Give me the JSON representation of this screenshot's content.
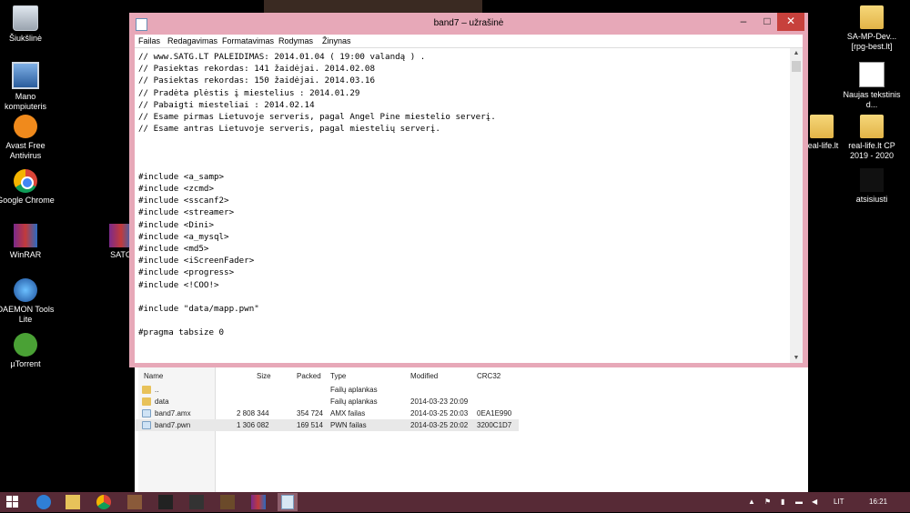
{
  "desktop": {
    "icons_left": [
      {
        "label": "Šiukšlinė",
        "icon": "recycle-bin-icon"
      },
      {
        "label": "Mano kompiuteris",
        "icon": "computer-icon"
      },
      {
        "label": "Avast Free Antivirus",
        "icon": "avast-icon"
      },
      {
        "label": "Google Chrome",
        "icon": "chrome-icon"
      },
      {
        "label": "WinRAR",
        "icon": "winrar-icon"
      },
      {
        "label": "DAEMON Tools Lite",
        "icon": "daemon-tools-icon"
      },
      {
        "label": "µTorrent",
        "icon": "utorrent-icon"
      }
    ],
    "icon_partial": "SATG",
    "icons_right": [
      {
        "label": "SA-MP-Dev... [rpg-best.lt]",
        "icon": "folder-icon"
      },
      {
        "label": "Naujas tekstinis d...",
        "icon": "text-document-icon"
      },
      {
        "label": "real-life.lt",
        "icon": "folder-icon"
      },
      {
        "label": "real-life.lt CP 2019 - 2020",
        "icon": "folder-icon"
      },
      {
        "label": "atsisiusti",
        "icon": "folder-icon"
      }
    ]
  },
  "notepad": {
    "title": "band7 – užrašinė",
    "menu": [
      "Failas",
      "Redagavimas",
      "Formatavimas",
      "Rodymas",
      "Žinynas"
    ],
    "lines": [
      "// www.SATG.LT PALEIDIMAS: 2014.01.04 ( 19:00 valandą ) .",
      "// Pasiektas rekordas: 141 žaidėjai. 2014.02.08",
      "// Pasiektas rekordas: 150 žaidėjai. 2014.03.16",
      "// Pradėta plėstis į miestelius : 2014.01.29",
      "// Pabaigti miesteliai : 2014.02.14",
      "// Esame pirmas Lietuvoje serveris, pagal Angel Pine miestelio serverį.",
      "// Esame antras Lietuvoje serveris, pagal miestelių serverį.",
      "",
      "",
      "",
      "#include <a_samp>",
      "#include <zcmd>",
      "#include <sscanf2>",
      "#include <streamer>",
      "#include <Dini>",
      "#include <a_mysql>",
      "#include <md5>",
      "#include <iScreenFader>",
      "#include <progress>",
      "#include <!COO!>",
      "",
      "#include \"data/mapp.pwn\"",
      "",
      "#pragma tabsize 0",
      ""
    ]
  },
  "filemanager": {
    "columns": [
      "Name",
      "Size",
      "Packed",
      "Type",
      "Modified",
      "CRC32"
    ],
    "rows": [
      {
        "name": "..",
        "size": "",
        "packed": "",
        "type": "Failų aplankas",
        "modified": "",
        "crc": "",
        "kind": "folder"
      },
      {
        "name": "data",
        "size": "",
        "packed": "",
        "type": "Failų aplankas",
        "modified": "2014-03-23 20:09",
        "crc": "",
        "kind": "folder"
      },
      {
        "name": "band7.amx",
        "size": "2 808 344",
        "packed": "354 724",
        "type": "AMX failas",
        "modified": "2014-03-25 20:03",
        "crc": "0EA1E990",
        "kind": "file"
      },
      {
        "name": "band7.pwn",
        "size": "1 306 082",
        "packed": "169 514",
        "type": "PWN failas",
        "modified": "2014-03-25 20:02",
        "crc": "3200C1D7",
        "kind": "file"
      }
    ]
  },
  "taskbar": {
    "language": "LIT",
    "time": "16:21",
    "accent": "#572a36"
  }
}
